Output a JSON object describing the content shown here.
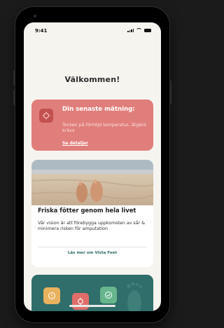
{
  "status_bar": {
    "time": "9:41"
  },
  "welcome": "Välkommen!",
  "latest_measurement": {
    "title": "Din senaste mätning:",
    "description": "Tecken på förhöjd temperatur, åtgärd krävs",
    "link": "Se detaljer",
    "color": "#e07e7b",
    "icon": "thermometer-alert-icon"
  },
  "article": {
    "title": "Friska fötter genom hela livet",
    "description": "Vår vision är att förebygga uppkomsten av sår & minimera risken för amputation",
    "link": "Läs mer om Vista Feet",
    "image": "feet-on-beach-photo"
  },
  "status_legend": {
    "color": "#2f6e6a",
    "tiles": [
      {
        "icon": "info-icon",
        "color": "#e9b25e"
      },
      {
        "icon": "alert-icon",
        "color": "#df6d6a"
      },
      {
        "icon": "check-icon",
        "color": "#67b58d"
      }
    ]
  }
}
